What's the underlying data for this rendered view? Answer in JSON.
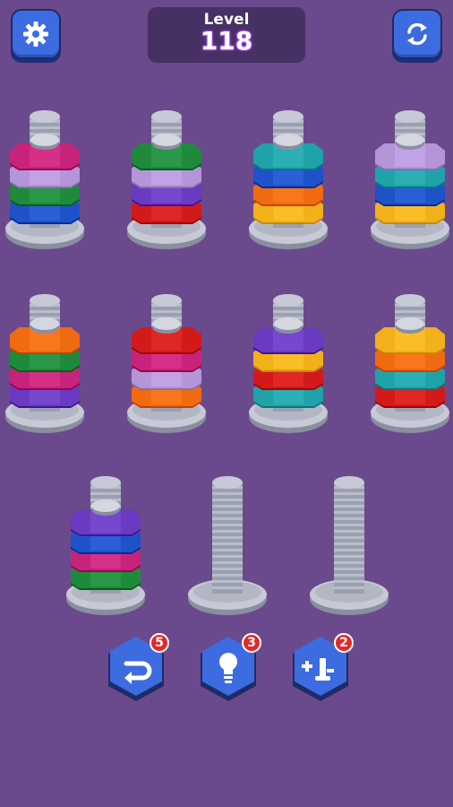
{
  "header": {
    "level_label": "Level",
    "level_number": "118",
    "settings_icon": "gear-icon",
    "restart_icon": "refresh-icon"
  },
  "colors": {
    "magenta": "#c8237a",
    "lavender": "#b496d8",
    "green": "#1f8a3c",
    "blue": "#1f52c8",
    "purple": "#6a3ac0",
    "red": "#d21a1a",
    "teal": "#1fa3a8",
    "orange": "#f06a10",
    "yellow": "#f2b01a"
  },
  "pegs": [
    {
      "nuts": [
        "blue",
        "green",
        "lavender",
        "magenta"
      ]
    },
    {
      "nuts": [
        "red",
        "purple",
        "lavender",
        "green"
      ]
    },
    {
      "nuts": [
        "yellow",
        "orange",
        "blue",
        "teal"
      ]
    },
    {
      "nuts": [
        "yellow",
        "blue",
        "teal",
        "lavender"
      ]
    },
    {
      "nuts": [
        "purple",
        "magenta",
        "green",
        "orange"
      ]
    },
    {
      "nuts": [
        "orange",
        "lavender",
        "magenta",
        "red"
      ]
    },
    {
      "nuts": [
        "teal",
        "red",
        "yellow",
        "purple"
      ]
    },
    {
      "nuts": [
        "red",
        "teal",
        "orange",
        "yellow"
      ]
    },
    {
      "nuts": [
        "green",
        "magenta",
        "blue",
        "purple"
      ]
    },
    {
      "nuts": []
    },
    {
      "nuts": []
    }
  ],
  "powerups": [
    {
      "icon": "undo-icon",
      "count": "5"
    },
    {
      "icon": "hint-bulb-icon",
      "count": "3"
    },
    {
      "icon": "add-screw-icon",
      "count": "2"
    }
  ]
}
